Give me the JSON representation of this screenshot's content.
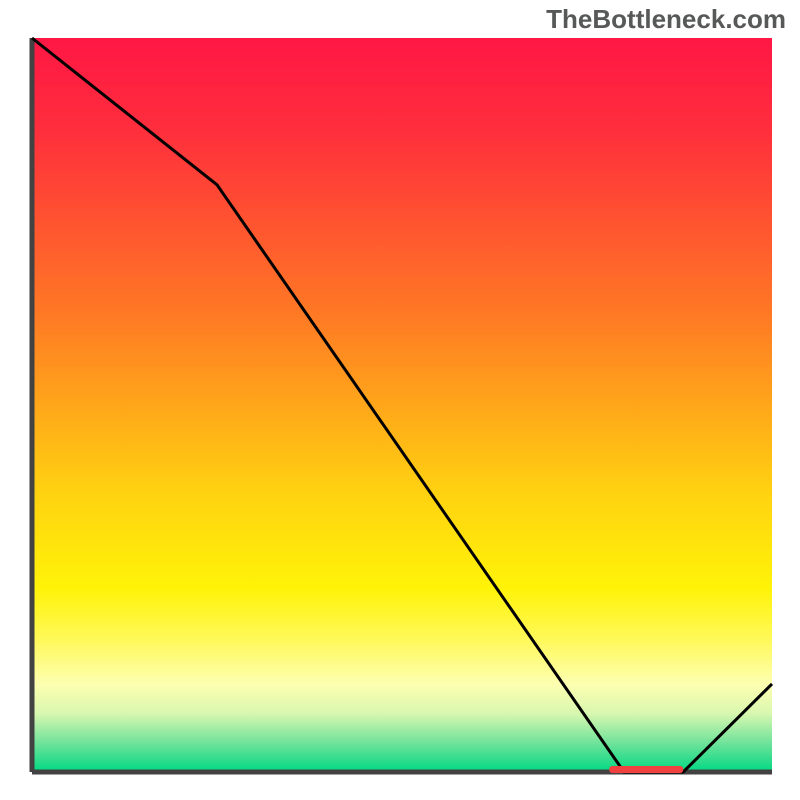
{
  "watermark": "TheBottleneck.com",
  "colors": {
    "axis": "#424242",
    "line": "#000000",
    "marker": "#f04040",
    "gradient_stops": [
      {
        "offset": 0.0,
        "color": "#ff1744"
      },
      {
        "offset": 0.12,
        "color": "#ff2d3d"
      },
      {
        "offset": 0.25,
        "color": "#ff5330"
      },
      {
        "offset": 0.38,
        "color": "#ff7a24"
      },
      {
        "offset": 0.5,
        "color": "#ffa61a"
      },
      {
        "offset": 0.62,
        "color": "#ffd210"
      },
      {
        "offset": 0.75,
        "color": "#fff308"
      },
      {
        "offset": 0.82,
        "color": "#fff95a"
      },
      {
        "offset": 0.88,
        "color": "#fdffb0"
      },
      {
        "offset": 0.92,
        "color": "#d9f7b0"
      },
      {
        "offset": 0.96,
        "color": "#71e39b"
      },
      {
        "offset": 1.0,
        "color": "#00d882"
      }
    ]
  },
  "chart_data": {
    "type": "line",
    "title": "",
    "xlabel": "",
    "ylabel": "",
    "x": [
      0.0,
      0.25,
      0.8,
      0.88,
      1.0
    ],
    "values": [
      1.0,
      0.8,
      0.0,
      0.0,
      0.12
    ],
    "xlim": [
      0,
      1
    ],
    "ylim": [
      0,
      1
    ],
    "marker": {
      "x_start": 0.78,
      "x_end": 0.88,
      "y": 0.0
    }
  }
}
